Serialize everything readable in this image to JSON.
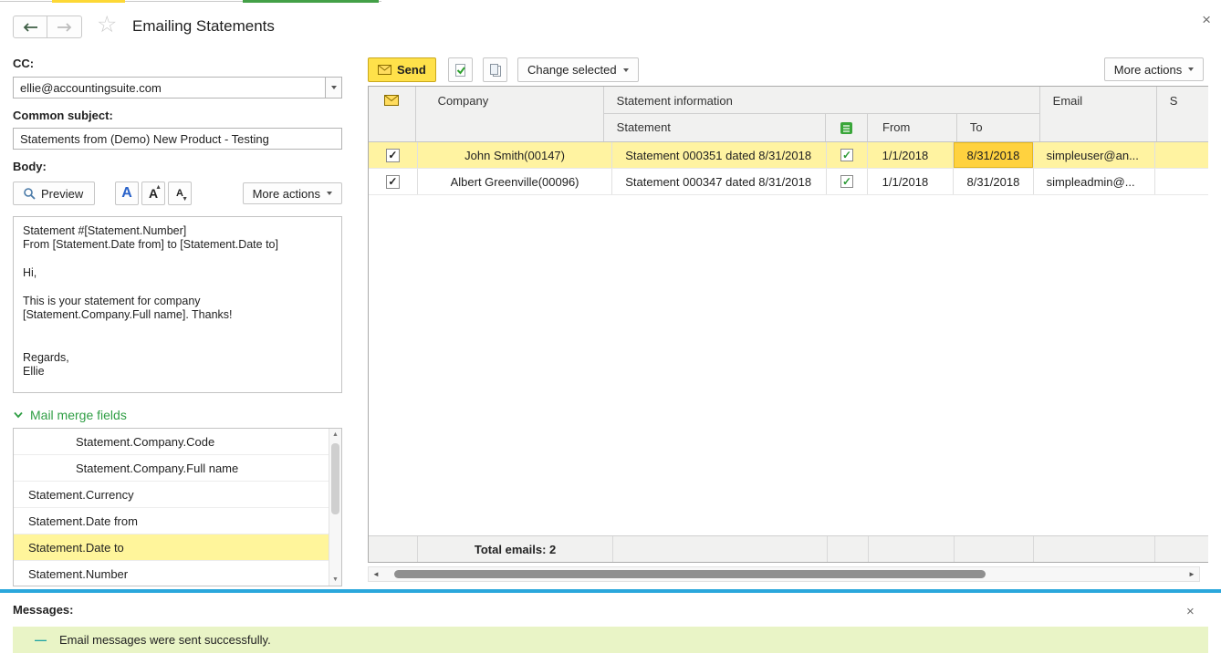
{
  "window": {
    "title": "Emailing Statements",
    "close": "×"
  },
  "left_panel": {
    "cc_label": "CC:",
    "cc_value": "ellie@accountingsuite.com",
    "subject_label": "Common subject:",
    "subject_value": "Statements from (Demo) New Product - Testing",
    "body_label": "Body:",
    "preview_label": "Preview",
    "font_color_label": "A",
    "font_increase_label": "A",
    "font_decrease_label": "A",
    "more_actions_label": "More actions",
    "body_text": "Statement #[Statement.Number]\nFrom [Statement.Date from] to [Statement.Date to]\n\nHi,\n\nThis is your statement for company\n[Statement.Company.Full name]. Thanks!\n\n\nRegards,\nEllie",
    "merge_fields_label": "Mail merge fields",
    "merge_fields": [
      "Statement.Company.Code",
      "Statement.Company.Full name",
      "Statement.Currency",
      "Statement.Date from",
      "Statement.Date to",
      "Statement.Number"
    ]
  },
  "table_toolbar": {
    "send_label": "Send",
    "change_selected_label": "Change selected",
    "more_actions_label": "More actions"
  },
  "statements_table": {
    "header": {
      "company": "Company",
      "statement_information": "Statement information",
      "statement": "Statement",
      "from": "From",
      "to": "To",
      "email": "Email",
      "clipped_column": "S"
    },
    "rows": [
      {
        "company": "John Smith(00147)",
        "statement": "Statement 000351 dated 8/31/2018",
        "from": "1/1/2018",
        "to": "8/31/2018",
        "email": "simpleuser@an..."
      },
      {
        "company": "Albert Greenville(00096)",
        "statement": "Statement 000347 dated 8/31/2018",
        "from": "1/1/2018",
        "to": "8/31/2018",
        "email": "simpleadmin@..."
      }
    ],
    "footer_total": "Total emails: 2"
  },
  "messages": {
    "label": "Messages:",
    "close": "×",
    "items": [
      {
        "text": "Email messages were sent successfully."
      }
    ]
  },
  "icons": {
    "star": "☆",
    "check": "✓",
    "scroll_up": "▲",
    "scroll_down": "▼",
    "scroll_left": "◄",
    "scroll_right": "►",
    "bullet_dash": "—",
    "font_up_mark": "▲",
    "font_down_mark": "▼"
  },
  "colors": {
    "selected_row": "#fff3a1",
    "active_cell": "#ffd23f",
    "selected_merge_field": "#fff59b",
    "send_button": "#ffe14a",
    "divider_blue": "#2aa7dc",
    "message_bg": "#e9f4c6",
    "merge_header_green": "#2f9e44"
  }
}
